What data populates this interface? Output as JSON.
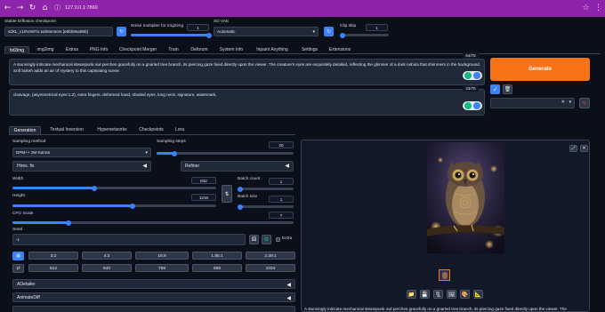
{
  "browser": {
    "back_icon": "←",
    "forward_icon": "→",
    "reload_icon": "↻",
    "home_icon": "⌂",
    "info_icon": "ⓘ",
    "url": "127.0.0.1:7860",
    "star_icon": "☆",
    "menu_icon": "⋮"
  },
  "top_settings": {
    "checkpoint_label": "Stable Diffusion checkpoint",
    "checkpoint_value": "sdXL_v10VAEFix.safetensors [e6bb9ea85b]",
    "noise_label": "Noise multiplier for img2img",
    "noise_value": "1",
    "noise_fraction": 1.0,
    "vae_label": "SD VAE",
    "vae_value": "Automatic",
    "clip_label": "Clip skip",
    "clip_value": "1"
  },
  "tabs": [
    "txt2img",
    "img2img",
    "Extras",
    "PNG Info",
    "Checkpoint Merger",
    "Train",
    "Deforum",
    "System Info",
    "Inpaint Anything",
    "Settings",
    "Extensions"
  ],
  "prompt": {
    "positive": "A stunningly intricate mechanical steampunk owl perches gracefully on a gnarled tree branch, its piercing gaze fixed directly upon the viewer. The creature's eyes are exquisitely detailed, reflecting the glimmer of a dark nebula that shimmers in the background. Soft bokeh adds an air of mystery to this captivating scene.",
    "positive_tokens": "64/75",
    "negative": "cleavage, (asymmetrical eyes:1.2), extra fingers, deformed hand, shaded eyes, long neck, signature, watermark,",
    "negative_tokens": "24/75"
  },
  "generate_label": "Generate",
  "sub_tabs": [
    "Generation",
    "Textual Inversion",
    "Hypernetworks",
    "Checkpoints",
    "Lora"
  ],
  "generation": {
    "sampling_method_label": "Sampling method",
    "sampling_method_value": "DPM++ 2M Karras",
    "sampling_steps_label": "Sampling steps",
    "sampling_steps_value": "20",
    "sampling_steps_fraction": 0.13,
    "hires_label": "Hires. fix",
    "refiner_label": "Refiner",
    "width_label": "Width",
    "width_value": "832",
    "width_fraction": 0.4,
    "height_label": "Height",
    "height_value": "1216",
    "height_fraction": 0.59,
    "batch_count_label": "Batch count",
    "batch_count_value": "1",
    "batch_size_label": "Batch size",
    "batch_size_value": "1",
    "cfg_label": "CFG Scale",
    "cfg_value": "7",
    "cfg_fraction": 0.2,
    "seed_label": "Seed",
    "seed_value": "-1",
    "extra_label": "Extra",
    "ratios": [
      "3:2",
      "4:3",
      "16:9",
      "1.85:1",
      "2.39:1"
    ],
    "sizes": [
      "512",
      "640",
      "768",
      "896",
      "1024"
    ],
    "adetailer_label": "ADetailer",
    "animatediff_label": "AnimateDiff"
  },
  "output": {
    "caption": "A stunningly intricate mechanical steampunk owl perches gracefully on a gnarled tree branch, its piercing gaze fixed directly upon the viewer. The"
  },
  "colors": {
    "generate": "#f97316",
    "accent": "#3b82f6",
    "chrome": "#8e24aa"
  }
}
